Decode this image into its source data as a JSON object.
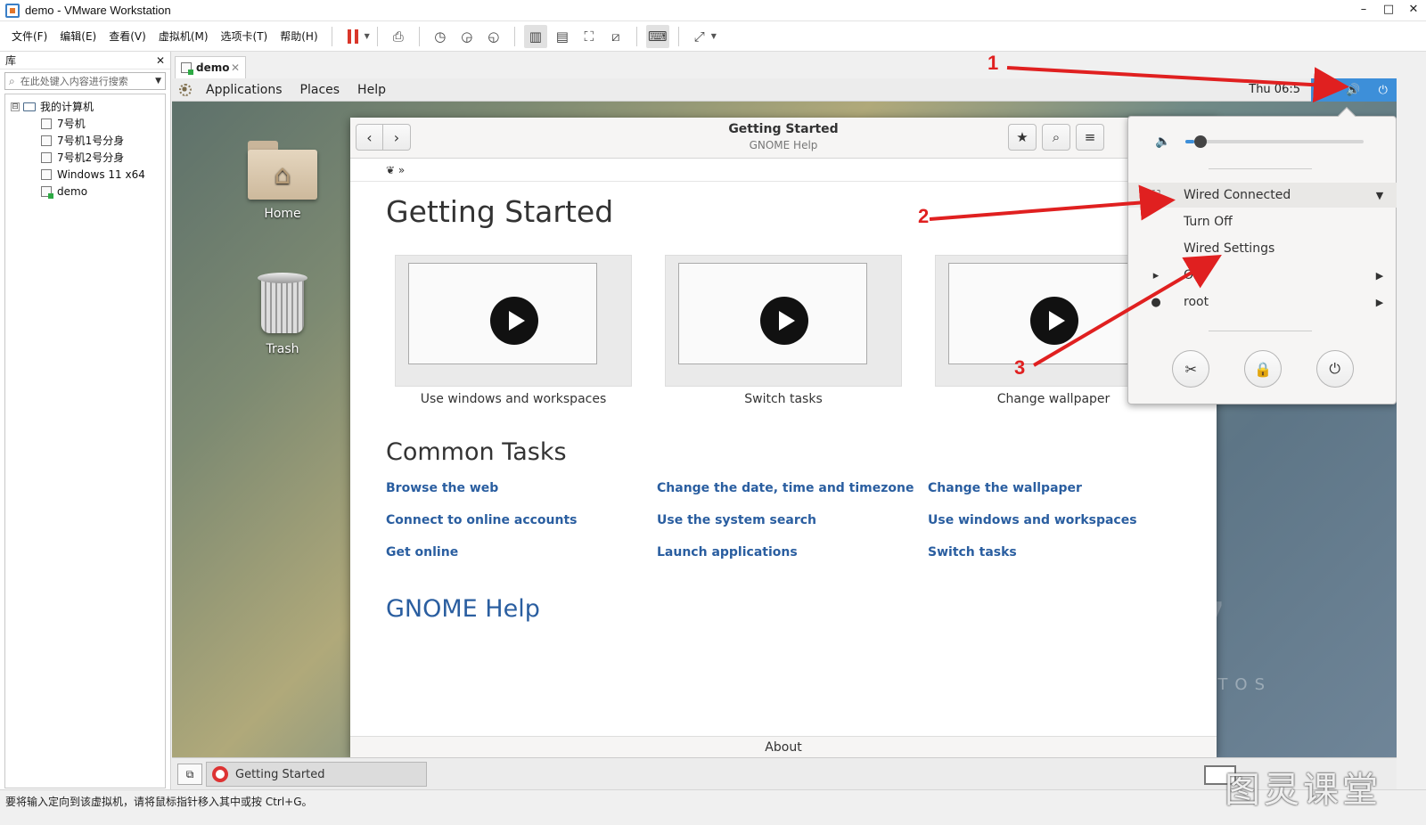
{
  "window": {
    "title": "demo - VMware Workstation",
    "controls": [
      "–",
      "□",
      "✕"
    ]
  },
  "vm_menu": [
    "文件(F)",
    "编辑(E)",
    "查看(V)",
    "虚拟机(M)",
    "选项卡(T)",
    "帮助(H)"
  ],
  "library": {
    "title": "库",
    "close": "✕",
    "search_placeholder": "在此处键入内容进行搜索",
    "root": "我的计算机",
    "toggle": "⊟",
    "items": [
      "7号机",
      "7号机1号分身",
      "7号机2号分身",
      "Windows 11 x64",
      "demo"
    ]
  },
  "vm_tab": {
    "label": "demo",
    "close": "✕"
  },
  "gnome": {
    "menus": [
      "Applications",
      "Places",
      "Help"
    ],
    "clock": "Thu 06:5",
    "desktop": {
      "home_label": "Home",
      "trash_label": "Trash"
    },
    "brand": "NTOS"
  },
  "help": {
    "title": "Getting Started",
    "subtitle": "GNOME Help",
    "crumb_sep": "»",
    "heading": "Getting Started",
    "videos": [
      "Use windows and workspaces",
      "Switch tasks",
      "Change wallpaper"
    ],
    "common_tasks_heading": "Common Tasks",
    "tasks": [
      [
        "Browse the web",
        "Change the date, time and timezone",
        "Change the wallpaper"
      ],
      [
        "Connect to online accounts",
        "Use the system search",
        "Use windows and workspaces"
      ],
      [
        "Get online",
        "Launch applications",
        "Switch tasks"
      ]
    ],
    "gnome_help": "GNOME Help",
    "footer": "About"
  },
  "status_menu": {
    "volume_level": 0.05,
    "wired_connected": "Wired Connected",
    "turn_off": "Turn Off",
    "wired_settings": "Wired Settings",
    "on": "On",
    "user": "root"
  },
  "taskbar": {
    "window_label": "Getting Started"
  },
  "vm_status": "要将输入定向到该虚拟机，请将鼠标指针移入其中或按 Ctrl+G。",
  "watermark": "图灵课堂",
  "annotations": [
    "1",
    "2",
    "3"
  ],
  "colors": {
    "accent": "#3d8fd9",
    "link": "#2a5ea0",
    "annotation": "#e02020"
  }
}
